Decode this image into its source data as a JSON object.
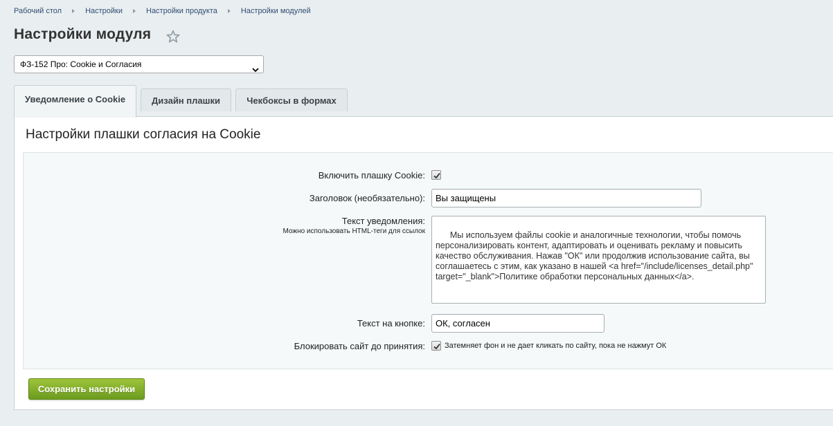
{
  "breadcrumb": {
    "items": [
      {
        "label": "Рабочий стол"
      },
      {
        "label": "Настройки"
      },
      {
        "label": "Настройки продукта"
      },
      {
        "label": "Настройки модулей"
      }
    ]
  },
  "page_title": "Настройки модуля",
  "module_select": {
    "value": "ФЗ-152 Про: Cookie и Согласия"
  },
  "tabs": [
    {
      "label": "Уведомление о Cookie",
      "active": true
    },
    {
      "label": "Дизайн плашки",
      "active": false
    },
    {
      "label": "Чекбоксы в формах",
      "active": false
    }
  ],
  "panel": {
    "title": "Настройки плашки согласия на Cookie",
    "fields": {
      "enable": {
        "label": "Включить плашку Cookie:",
        "checked": true
      },
      "heading": {
        "label": "Заголовок (необязательно):",
        "value": "Вы защищены"
      },
      "notice": {
        "label": "Текст уведомления:",
        "hint": "Можно использовать HTML-теги для ссылок",
        "value": "Мы используем файлы cookie и аналогичные технологии, чтобы помочь персонализировать контент, адаптировать и оценивать рекламу и повысить качество обслуживания. Нажав \"ОК\" или продолжив использование сайта, вы соглашаетесь с этим, как указано в нашей <a href=\"/include/licenses_detail.php\" target=\"_blank\">Политике обработки персональных данных</a>."
      },
      "button_text": {
        "label": "Текст на кнопке:",
        "value": "ОК, согласен"
      },
      "block_site": {
        "label": "Блокировать сайт до принятия:",
        "checked": true,
        "description": "Затемняет фон и не дает кликать по сайту, пока не нажмут ОК"
      }
    }
  },
  "save_button": {
    "label": "Сохранить настройки"
  },
  "icons": {
    "favorite": "star-icon",
    "select_arrow": "chevron-down-icon",
    "check": "check-icon"
  },
  "colors": {
    "accent_green": "#7aa82a",
    "link": "#2f4d74",
    "background": "#e9eef0"
  }
}
